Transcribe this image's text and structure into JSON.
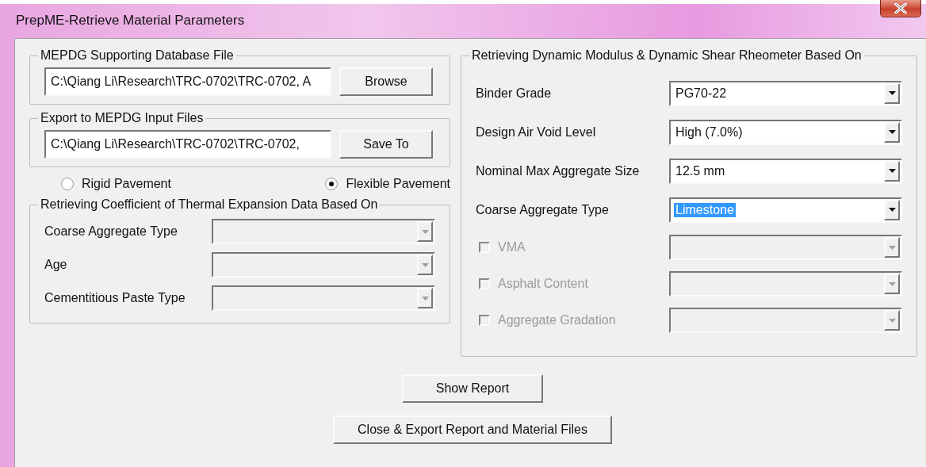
{
  "window": {
    "title": "PrepME-Retrieve Material Parameters"
  },
  "database_file": {
    "label": "MEPDG Supporting Database File",
    "value": "C:\\Qiang Li\\Research\\TRC-0702\\TRC-0702, A",
    "button": "Browse"
  },
  "export_files": {
    "label": "Export to MEPDG Input Files",
    "value": "C:\\Qiang Li\\Research\\TRC-0702\\TRC-0702,",
    "button": "Save To"
  },
  "pavement_options": [
    {
      "label": "Rigid Pavement",
      "selected": false
    },
    {
      "label": "Flexible Pavement",
      "selected": true
    }
  ],
  "cte_group": {
    "title": "Retrieving Coefficient of Thermal Expansion Data Based On",
    "fields": [
      {
        "label": "Coarse Aggregate Type",
        "disabled": true
      },
      {
        "label": "Age",
        "disabled": true
      },
      {
        "label": "Cementitious Paste Type",
        "disabled": true
      }
    ]
  },
  "dm_group": {
    "title": "Retrieving Dynamic Modulus & Dynamic Shear Rheometer Based On",
    "fields": [
      {
        "kind": "select",
        "label": "Binder Grade",
        "value": "PG70-22",
        "text_selected": false,
        "disabled": false
      },
      {
        "kind": "select",
        "label": "Design Air Void Level",
        "value": "High (7.0%)",
        "text_selected": false,
        "disabled": false
      },
      {
        "kind": "select",
        "label": "Nominal Max Aggregate Size",
        "value": "12.5 mm",
        "text_selected": false,
        "disabled": false
      },
      {
        "kind": "select",
        "label": "Coarse Aggregate Type",
        "value": "Limestone",
        "text_selected": true,
        "disabled": false
      },
      {
        "kind": "checkbox",
        "label": "VMA",
        "checked": false,
        "disabled": true
      },
      {
        "kind": "checkbox",
        "label": "Asphalt Content",
        "checked": false,
        "disabled": true
      },
      {
        "kind": "checkbox",
        "label": "Aggregate Gradation",
        "checked": false,
        "disabled": true
      }
    ]
  },
  "buttons": [
    {
      "label": "Show Report"
    },
    {
      "label": "Close & Export Report and Material Files"
    }
  ]
}
